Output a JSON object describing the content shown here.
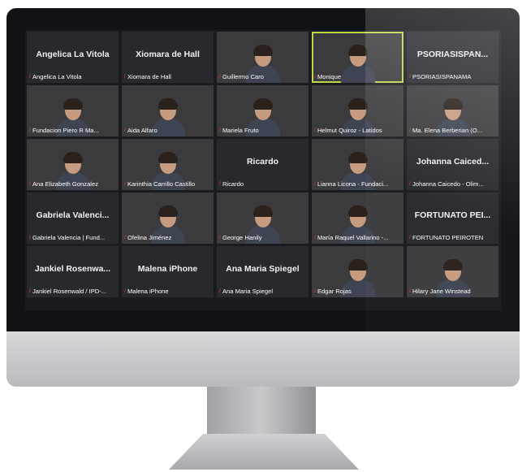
{
  "tiles": [
    {
      "title": "Angelica La Vitola",
      "label": "Angelica La Vitola",
      "video": false
    },
    {
      "title": "Xiomara de Hall",
      "label": "Xiomara de Hall",
      "video": false
    },
    {
      "title": "",
      "label": "Guillermo Caro",
      "video": true
    },
    {
      "title": "",
      "label": "Monique",
      "video": true,
      "active": true
    },
    {
      "title": "PSORIASISPAN...",
      "label": "PSORIASISPANAMA",
      "video": false
    },
    {
      "title": "",
      "label": "Fundacion Piero R Ma...",
      "video": true
    },
    {
      "title": "",
      "label": "Aida Alfaro",
      "video": true
    },
    {
      "title": "",
      "label": "Mariela Fruto",
      "video": true
    },
    {
      "title": "",
      "label": "Helmut Quiroz - Latidos",
      "video": true
    },
    {
      "title": "",
      "label": "Ma. Elena Berberian (O...",
      "video": true
    },
    {
      "title": "",
      "label": "Ana Elizabeth Gonzalez",
      "video": true
    },
    {
      "title": "",
      "label": "Karinthia Carrillo Castillo",
      "video": true
    },
    {
      "title": "Ricardo",
      "label": "Ricardo",
      "video": false
    },
    {
      "title": "",
      "label": "Lianna Licona - Fundaci...",
      "video": true
    },
    {
      "title": "Johanna Caiced...",
      "label": "Johanna Caicedo - Olim...",
      "video": false
    },
    {
      "title": "Gabriela Valenci...",
      "label": "Gabriela Valencia | Fund...",
      "video": false
    },
    {
      "title": "",
      "label": "Ofelina Jiménez",
      "video": true
    },
    {
      "title": "",
      "label": "George Hanily",
      "video": true
    },
    {
      "title": "",
      "label": "María Raquel Vallarino -...",
      "video": true
    },
    {
      "title": "FORTUNATO PEI...",
      "label": "FORTUNATO PEIROTEN",
      "video": false
    },
    {
      "title": "Jankiel Rosenwa...",
      "label": "Jankiel Rosenwald / IPD-...",
      "video": false
    },
    {
      "title": "Malena iPhone",
      "label": "Malena iPhone",
      "video": false
    },
    {
      "title": "Ana Maria Spiegel",
      "label": "Ana Maria Spiegel",
      "video": false
    },
    {
      "title": "",
      "label": "Edgar Rojas",
      "video": true
    },
    {
      "title": "",
      "label": "Hilary Jane Winstead",
      "video": true
    }
  ],
  "colors": {
    "active_border": "#b9d84a",
    "muted_mic": "#e0403a"
  }
}
